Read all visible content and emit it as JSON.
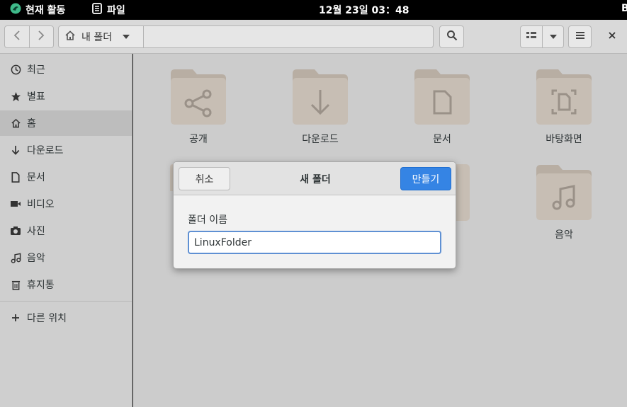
{
  "topbar": {
    "activities_label": "현재 활동",
    "app_label": "파일",
    "clock": "12월 23일  03：48",
    "edge_char": "B"
  },
  "header": {
    "path_label": "내 폴더",
    "icons": [
      "back-icon",
      "forward-icon",
      "home-icon",
      "dropdown-icon",
      "search-icon",
      "list-view-icon",
      "chevron-down-icon",
      "menu-icon",
      "close-icon"
    ]
  },
  "sidebar": {
    "items": [
      {
        "label": "최근",
        "icon": "clock-icon"
      },
      {
        "label": "별표",
        "icon": "star-icon"
      },
      {
        "label": "홈",
        "icon": "home-icon"
      },
      {
        "label": "다운로드",
        "icon": "download-icon"
      },
      {
        "label": "문서",
        "icon": "document-icon"
      },
      {
        "label": "비디오",
        "icon": "video-icon"
      },
      {
        "label": "사진",
        "icon": "camera-icon"
      },
      {
        "label": "음악",
        "icon": "music-icon"
      },
      {
        "label": "휴지통",
        "icon": "trash-icon"
      }
    ],
    "other_locations": "다른 위치"
  },
  "folders": [
    {
      "label": "공개",
      "icon": "share-icon"
    },
    {
      "label": "다운로드",
      "icon": "download-icon"
    },
    {
      "label": "문서",
      "icon": "document-icon"
    },
    {
      "label": "바탕화면",
      "icon": "desktop-icon"
    },
    {
      "label": "음악",
      "icon": "music-icon"
    }
  ],
  "dialog": {
    "title": "새 폴더",
    "cancel_label": "취소",
    "create_label": "만들기",
    "field_label": "폴더 이름",
    "field_value": "LinuxFolder"
  },
  "colors": {
    "accent": "#3584e4",
    "folder": "#c7beb4",
    "folder_tab": "#b8aea3",
    "folder_glyph": "#9a9188"
  }
}
